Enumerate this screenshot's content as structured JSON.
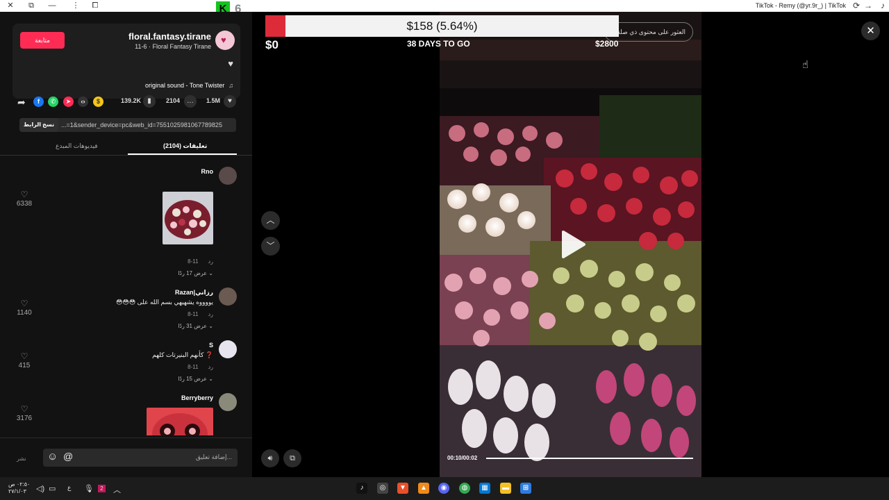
{
  "window": {
    "title": "TikTok - Remy (@yr.9r_) | TikTok",
    "badge_letter": "K",
    "badge_number": "6"
  },
  "author": {
    "follow_label": "متابعة",
    "username": "floral.fantasy.tirane",
    "subtitle": "11-6 · Floral Fantasy Tirane",
    "sound": "original sound - Tone Twister"
  },
  "stats": {
    "likes": "1.5M",
    "comments": "2104",
    "saves": "139.2K"
  },
  "share": {
    "copy_label": "نسخ الرابط",
    "url": "...=1&sender_device=pc&web_id=7551025981067789825"
  },
  "tabs": [
    {
      "label": "تعليقات (2104)"
    },
    {
      "label": "فيديوهات المبدع"
    }
  ],
  "comments": [
    {
      "name": "Rno",
      "text": "",
      "date": "11-8",
      "reply": "رد",
      "replies": "عرض 17 ردًا",
      "likes": "6338"
    },
    {
      "name": "Razan|رزاني",
      "text": "😳😳😳 يووووه يشهيهي بسم الله على",
      "date": "11-8",
      "reply": "رد",
      "replies": "عرض 31 ردًا",
      "likes": "1140"
    },
    {
      "name": "S",
      "text": "كأنهم البنيرتات كلهم ❓",
      "date": "11-8",
      "reply": "رد",
      "replies": "عرض 15 ردًا",
      "likes": "415"
    },
    {
      "name": "Berryberry",
      "text": "",
      "date": "",
      "reply": "",
      "replies": "",
      "likes": "3176"
    }
  ],
  "composer": {
    "post_label": "نشر",
    "placeholder": "إضافة تعليق..."
  },
  "fundraiser": {
    "amount_text": "$158 (5.64%)",
    "progress": 0.0564,
    "start": "$0",
    "days_left": "38 DAYS TO GO",
    "goal": "$2800"
  },
  "video": {
    "related_label": "العثور على محتوى ذي صلة",
    "timecode": "00:10/00:02",
    "progress": 1.0
  },
  "taskbar": {
    "time": "٠٢:٥٠ ص",
    "date": "٢٧/١/٠٣",
    "lang": "ع"
  },
  "colors": {
    "accent": "#fe2c55",
    "fund_fill": "#dd2b3a"
  }
}
